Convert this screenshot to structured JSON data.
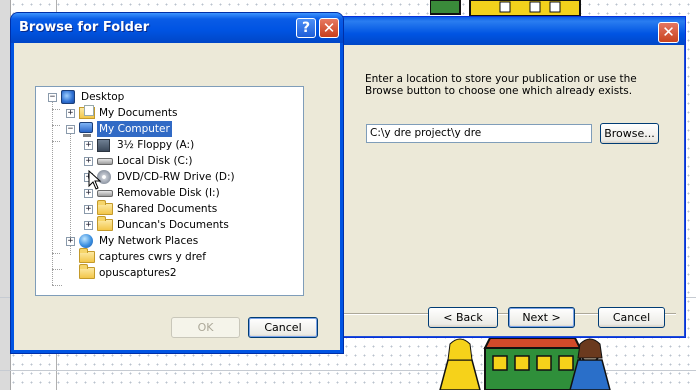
{
  "browse_dialog": {
    "title": "Browse for Folder",
    "help_glyph": "?",
    "close_glyph": "✕",
    "ok_label": "OK",
    "cancel_label": "Cancel",
    "tree": [
      {
        "label": "Desktop",
        "icon": "desktop-icon",
        "expander": "minus"
      },
      {
        "label": "My Documents",
        "icon": "my-documents-icon",
        "expander": "plus"
      },
      {
        "label": "My Computer",
        "icon": "computer-icon",
        "expander": "minus",
        "selected": true
      },
      {
        "label": "3½ Floppy (A:)",
        "icon": "floppy-icon",
        "expander": "plus"
      },
      {
        "label": "Local Disk (C:)",
        "icon": "drive-icon",
        "expander": "plus"
      },
      {
        "label": "DVD/CD-RW Drive (D:)",
        "icon": "cdrom-icon",
        "expander": "plus"
      },
      {
        "label": "Removable Disk (I:)",
        "icon": "drive-icon",
        "expander": "plus"
      },
      {
        "label": "Shared Documents",
        "icon": "folder-icon",
        "expander": "plus"
      },
      {
        "label": "Duncan's Documents",
        "icon": "folder-icon",
        "expander": "plus"
      },
      {
        "label": "My Network Places",
        "icon": "network-icon",
        "expander": "plus"
      },
      {
        "label": "captures cwrs y dref",
        "icon": "folder-icon",
        "expander": "none"
      },
      {
        "label": "opuscaptures2",
        "icon": "folder-icon",
        "expander": "none"
      }
    ]
  },
  "wizard": {
    "close_glyph": "✕",
    "instruction": "Enter a location to store your publication or use the Browse button to choose one which already exists.",
    "path_value": "C:\\y dre project\\y dre",
    "browse_label": "Browse...",
    "back_label": "< Back",
    "next_label": "Next >",
    "cancel_label": "Cancel"
  },
  "colors": {
    "xp_title_blue": "#0054e3",
    "selection_blue": "#316ac5",
    "dialog_face": "#ece9d8",
    "close_red": "#c83e1b"
  }
}
